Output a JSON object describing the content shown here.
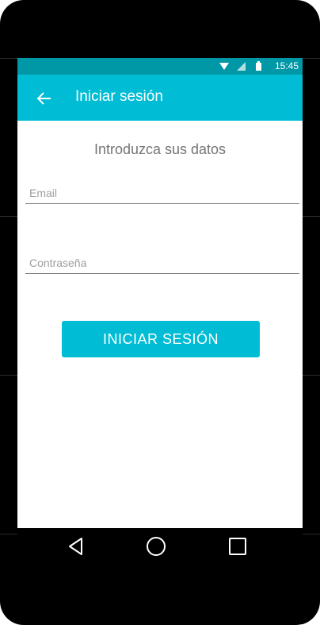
{
  "status_bar": {
    "time": "15:45",
    "icons": [
      "wifi-icon",
      "signal-icon",
      "battery-icon"
    ]
  },
  "app_bar": {
    "back_icon": "arrow-left-icon",
    "title": "Iniciar sesión"
  },
  "form": {
    "heading": "Introduzca sus datos",
    "email": {
      "placeholder": "Email",
      "value": ""
    },
    "password": {
      "placeholder": "Contraseña",
      "value": ""
    },
    "submit_label": "INICIAR SESIÓN"
  },
  "nav_bar": {
    "buttons": [
      "back-triangle-icon",
      "home-circle-icon",
      "recents-square-icon"
    ]
  },
  "colors": {
    "primary": "#00bcd4",
    "primary_dark": "#0097a7",
    "text_muted": "#757575"
  }
}
